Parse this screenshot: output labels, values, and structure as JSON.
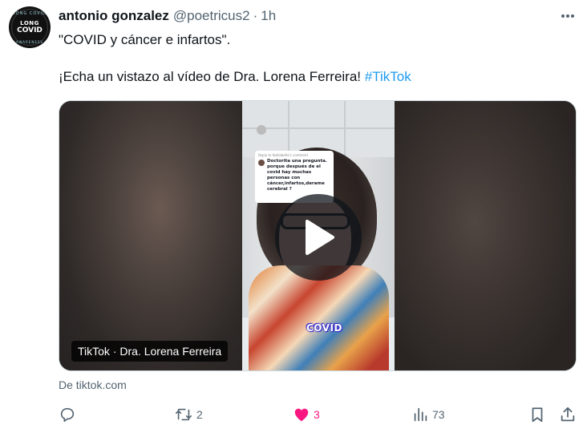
{
  "tweet": {
    "author": {
      "name": "antonio gonzalez",
      "handle": "@poetricus2",
      "separator": "·",
      "time": "1h",
      "avatar_text": {
        "top_arc": "LONG COVID",
        "line1": "LONG",
        "line2": "COVID",
        "bottom_arc": "AWARENESS"
      }
    },
    "text": {
      "line1": "\"COVID y cáncer e infartos\".",
      "line2": "¡Echa un vistazo al vídeo de Dra. Lorena Ferreira! ",
      "hashtag": "#TikTok"
    },
    "card": {
      "badge": "TikTok · Dra. Lorena Ferreira",
      "source": "De tiktok.com",
      "video_caption": "COVID",
      "comment_reply_label": "Reply to tbellabella's comment",
      "comment_text": "Doctorita una pregunta. porque después de el covid hay muchas personas con cáncer,infartos,derame cerebral ?"
    },
    "actions": {
      "replies": "",
      "retweets": "2",
      "likes": "3",
      "views": "73"
    },
    "colors": {
      "text": "#0f1419",
      "secondary": "#536471",
      "link": "#1d9bf0",
      "like": "#f91880"
    },
    "icons": {
      "more": "more-horizontal-icon",
      "reply": "reply-icon",
      "retweet": "retweet-icon",
      "like": "heart-filled-icon",
      "views": "views-icon",
      "bookmark": "bookmark-icon",
      "share": "share-icon",
      "play": "play-icon"
    }
  }
}
